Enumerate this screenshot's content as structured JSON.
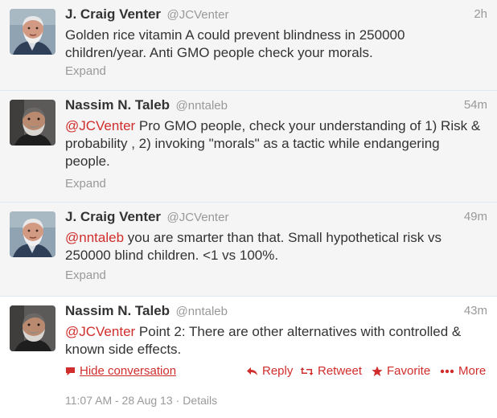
{
  "tweets": [
    {
      "name": "J. Craig Venter",
      "handle": "@JCVenter",
      "time": "2h",
      "mention": "",
      "text": "Golden rice vitamin A could prevent blindness in 250000 children/year. Anti GMO people check your morals.",
      "expand": "Expand"
    },
    {
      "name": "Nassim N. Taleb",
      "handle": "@nntaleb",
      "time": "54m",
      "mention": "@JCVenter",
      "text": " Pro GMO people, check your understanding of 1) Risk & probability , 2) invoking \"morals\" as a tactic while endangering people.",
      "expand": "Expand"
    },
    {
      "name": "J. Craig Venter",
      "handle": "@JCVenter",
      "time": "49m",
      "mention": "@nntaleb",
      "text": " you are smarter than that. Small hypothetical risk vs 250000 blind children. <1 vs 100%.",
      "expand": "Expand"
    },
    {
      "name": "Nassim N. Taleb",
      "handle": "@nntaleb",
      "time": "43m",
      "mention": "@JCVenter",
      "text": " Point 2: There are other alternatives with controlled & known side effects."
    }
  ],
  "actions": {
    "hide": "Hide conversation",
    "reply": "Reply",
    "retweet": "Retweet",
    "favorite": "Favorite",
    "more": "More"
  },
  "footer": {
    "timestamp": "11:07 AM - 28 Aug 13",
    "separator": "·",
    "details": "Details"
  },
  "colors": {
    "accent": "#d02d2d",
    "muted": "#999999",
    "text": "#333333",
    "expanded_bg": "#f5f5f5"
  },
  "icons": [
    "speech-bubble-icon",
    "reply-arrow-icon",
    "retweet-icon",
    "star-icon",
    "ellipsis-icon"
  ]
}
